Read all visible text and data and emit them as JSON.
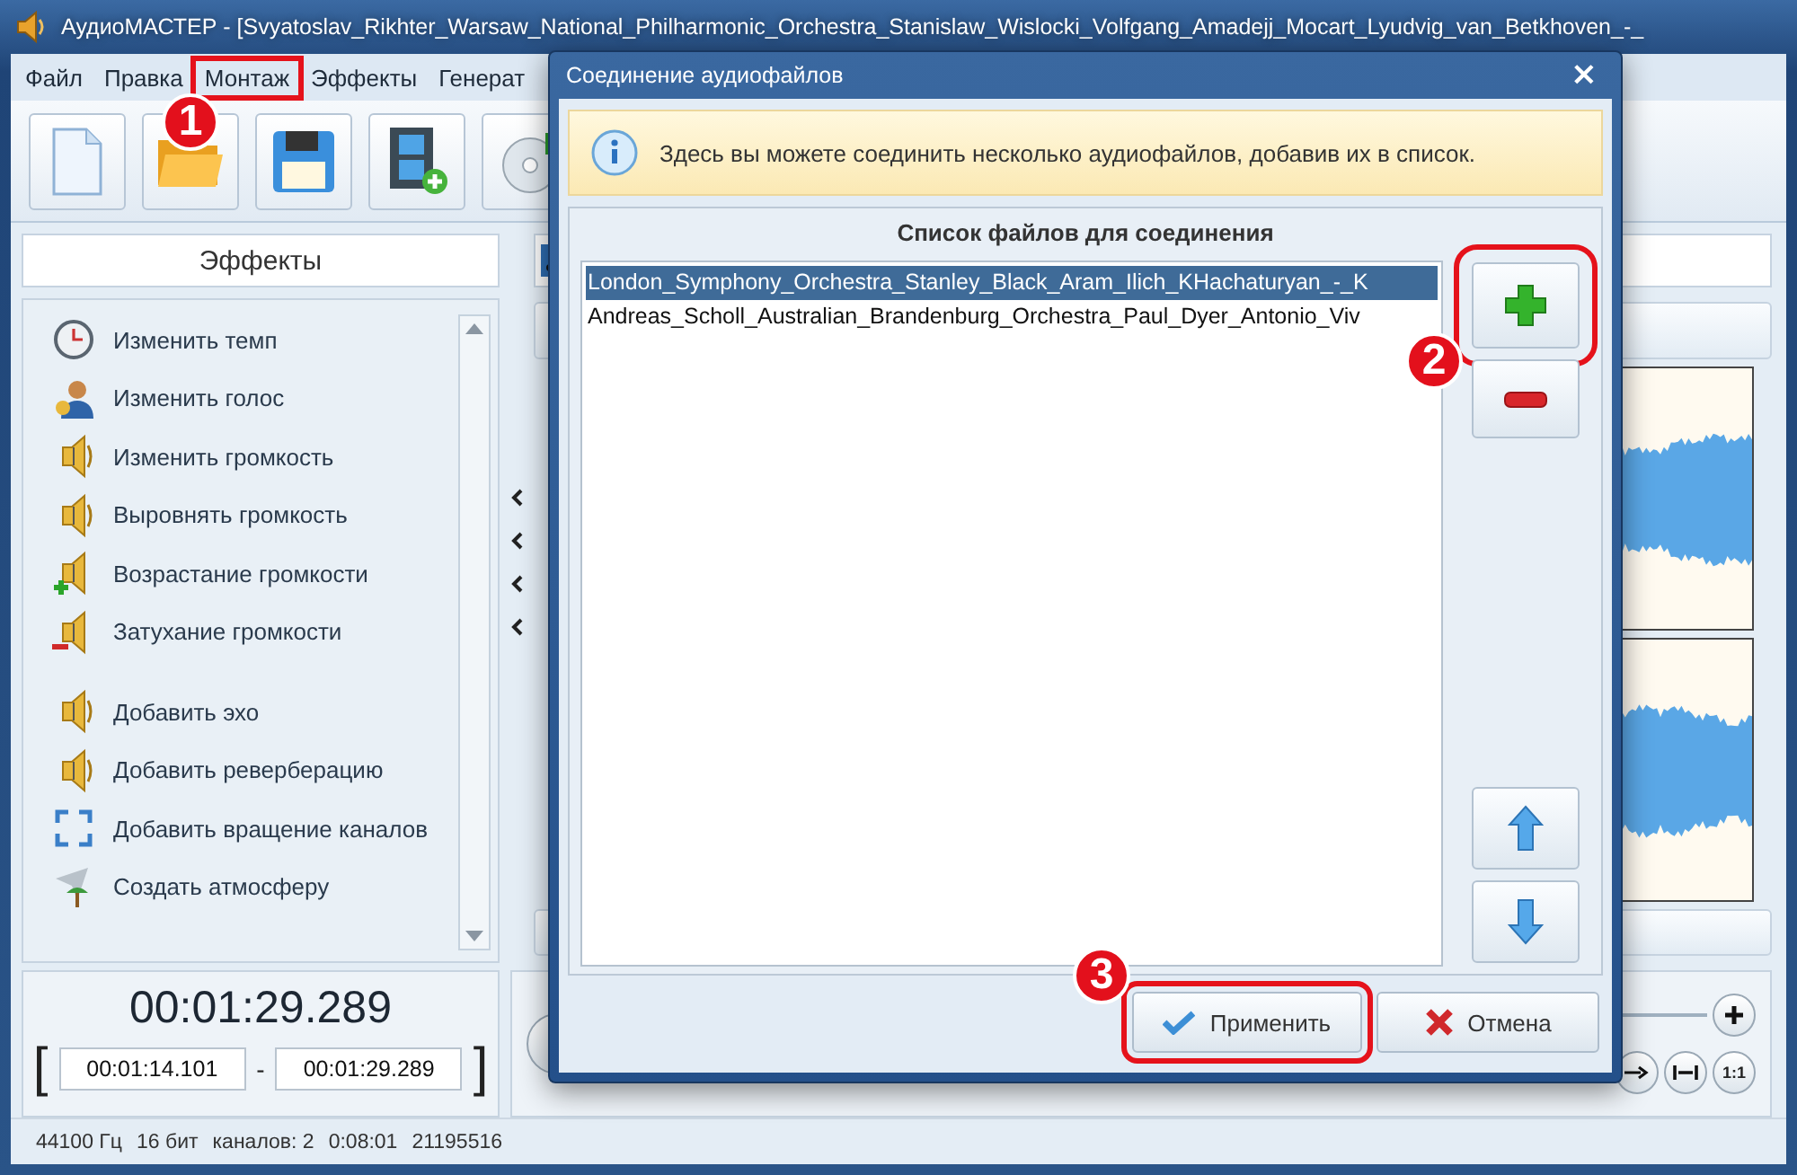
{
  "window": {
    "title": "АудиоМАСТЕР - [Svyatoslav_Rikhter_Warsaw_National_Philharmonic_Orchestra_Stanislaw_Wislocki_Volfgang_Amadejj_Mocart_Lyudvig_van_Betkhoven_-_"
  },
  "menu": [
    {
      "label": "Файл"
    },
    {
      "label": "Правка"
    },
    {
      "label": "Монтаж",
      "callout": "1"
    },
    {
      "label": "Эффекты"
    },
    {
      "label": "Генерат"
    }
  ],
  "toolbar": [
    {
      "kind": "new"
    },
    {
      "kind": "open"
    },
    {
      "kind": "save"
    },
    {
      "kind": "video"
    },
    {
      "kind": "disc"
    }
  ],
  "effects": {
    "title": "Эффекты",
    "items": [
      {
        "label": "Изменить темп",
        "kind": "clock"
      },
      {
        "label": "Изменить голос",
        "kind": "person"
      },
      {
        "label": "Изменить громкость",
        "kind": "speaker"
      },
      {
        "label": "Выровнять громкость",
        "kind": "speaker"
      },
      {
        "label": "Возрастание громкости",
        "kind": "speaker-plus"
      },
      {
        "label": "Затухание громкости",
        "kind": "speaker-minus"
      },
      {
        "label": "Добавить эхо",
        "kind": "speaker"
      },
      {
        "label": "Добавить реверберацию",
        "kind": "speaker"
      },
      {
        "label": "Добавить вращение каналов",
        "kind": "rotate"
      },
      {
        "label": "Создать атмосферу",
        "kind": "plane"
      }
    ]
  },
  "time": {
    "current": "00:01:29.289",
    "open_bracket": "[",
    "start": "00:01:14.101",
    "separator": "-",
    "end": "00:01:29.289",
    "close_bracket": "]"
  },
  "zoom_controls": {
    "fit_label": "1:1"
  },
  "status_bar": [
    "44100 Гц",
    "16 бит",
    "каналов: 2",
    "0:08:01",
    "21195516"
  ],
  "dialog": {
    "title": "Соединение аудиофайлов",
    "close": "×",
    "info": "Здесь вы можете соединить несколько аудиофайлов, добавив их в список.",
    "list_title": "Список файлов для соединения",
    "files": [
      {
        "name": "London_Symphony_Orchestra_Stanley_Black_Aram_Ilich_KHachaturyan_-_K",
        "selected": true
      },
      {
        "name": "Andreas_Scholl_Australian_Brandenburg_Orchestra_Paul_Dyer_Antonio_Viv",
        "selected": false
      }
    ],
    "side_buttons": [
      {
        "kind": "add",
        "callout": "2"
      },
      {
        "kind": "remove"
      },
      {
        "kind": "up"
      },
      {
        "kind": "down"
      }
    ],
    "footer": [
      {
        "label": "Применить",
        "kind": "apply",
        "callout": "3"
      },
      {
        "label": "Отмена",
        "kind": "cancel"
      }
    ]
  }
}
